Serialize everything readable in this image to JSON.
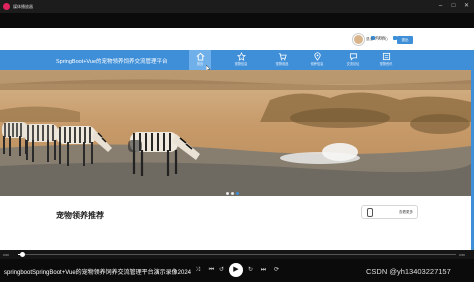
{
  "player": {
    "window_title": "媒体播放器",
    "video_title": "springbootSpringBoot+Vue的宠物领养饲养交流管理平台演示录像2024",
    "time_current": "0:00",
    "time_total": "3:50",
    "progress": 0.01,
    "watermark": "CSDN @yh13403227157"
  },
  "site": {
    "title": "SpringBoot+Vue的宠物领养饲养交流管理平台",
    "top_links": [
      "购物车",
      "我的订单"
    ],
    "user_links": "退出  个人中心",
    "exit_label": "退出",
    "nav_items": [
      {
        "label": "首页",
        "icon": "home-icon",
        "active": true
      },
      {
        "label": "宠物信息",
        "icon": "star-icon",
        "active": false
      },
      {
        "label": "宠物用品",
        "icon": "cart-icon",
        "active": false
      },
      {
        "label": "领养信息",
        "icon": "pin-icon",
        "active": false
      },
      {
        "label": "交流论坛",
        "icon": "chat-icon",
        "active": false
      },
      {
        "label": "宠物资讯",
        "icon": "news-icon",
        "active": false
      }
    ],
    "section_title": "宠物领养推荐",
    "float_label": "查看更多",
    "carousel_count": 3,
    "carousel_active": 2
  },
  "colors": {
    "brand": "#3f8fd8",
    "player_bg": "#0b0b0b"
  }
}
